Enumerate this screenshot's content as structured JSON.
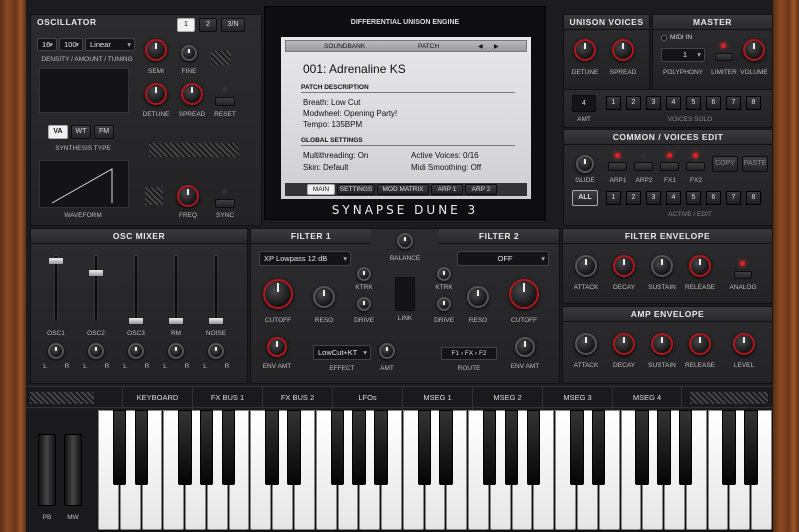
{
  "oscillator": {
    "title": "OSCILLATOR",
    "mode_buttons": [
      "1",
      "2",
      "3/N"
    ],
    "density": "16",
    "amount": "100",
    "tuning": "Linear",
    "density_label": "DENSITY / AMOUNT / TUNING",
    "semi": "SEMI",
    "fine": "FINE",
    "detune": "DETUNE",
    "spread": "SPREAD",
    "reset": "RESET",
    "synth_types": [
      "VA",
      "WT",
      "FM"
    ],
    "synthesis_type_label": "SYNTHESIS TYPE",
    "waveform": "WAVEFORM",
    "freq": "FREQ",
    "sync": "SYNC"
  },
  "engine": {
    "title": "DIFFERENTIAL UNISON ENGINE",
    "nav_soundbank": "SOUNDBANK",
    "nav_patch": "PATCH",
    "nav_prev": "◀",
    "nav_next": "▶",
    "patch_name": "001: Adrenaline KS",
    "patch_desc_title": "PATCH DESCRIPTION",
    "desc_lines": [
      "Breath: Low Cut",
      "Modwheel: Opening Party!",
      "Tempo: 135BPM"
    ],
    "global_title": "GLOBAL SETTINGS",
    "multithreading": "Multithreading: On",
    "active_voices": "Active Voices: 0/16",
    "skin": "Skin: Default",
    "midi_smoothing": "Midi Smoothing: Off",
    "tabs": [
      "MAIN",
      "SETTINGS",
      "MOD MATRIX",
      "ARP 1",
      "ARP 2"
    ],
    "logo": "SYNAPSE DUNE 3"
  },
  "unison": {
    "title": "UNISON VOICES",
    "detune": "DETUNE",
    "spread": "SPREAD",
    "amt_value": "4",
    "amt": "AMT",
    "voices": [
      "1",
      "2",
      "3",
      "4",
      "5",
      "6",
      "7",
      "8"
    ],
    "voices_solo": "VOICES SOLO"
  },
  "master": {
    "title": "MASTER",
    "midi_in": "MIDI IN",
    "polyphony_value": "1",
    "polyphony": "POLYPHONY",
    "limiter": "LIMITER",
    "volume": "VOLUME"
  },
  "common": {
    "title": "COMMON / VOICES EDIT",
    "glide": "GLIDE",
    "arps": [
      "ARP1",
      "ARP2",
      "FX1",
      "FX2"
    ],
    "copy": "COPY",
    "paste": "PASTE",
    "all": "ALL",
    "voices": [
      "1",
      "2",
      "3",
      "4",
      "5",
      "6",
      "7",
      "8"
    ],
    "active_edit": "ACTIVE / EDIT"
  },
  "osc_mixer": {
    "title": "OSC MIXER",
    "channels": [
      "OSC1",
      "OSC2",
      "OSC3",
      "RM",
      "NOISE"
    ],
    "l": "L",
    "r": "R"
  },
  "filters": {
    "filter1": "FILTER 1",
    "filter2": "FILTER 2",
    "filter1_type": "XP Lowpass 12 dB",
    "filter2_type": "OFF",
    "balance": "BALANCE",
    "cutoff": "CUTOFF",
    "reso": "RESO",
    "ktrk": "KTRK",
    "drive": "DRIVE",
    "link": "LINK",
    "env_amt": "ENV AMT",
    "effect_value": "LowCut+KT",
    "effect": "EFFECT",
    "amt": "AMT",
    "route": "ROUTE",
    "route_f1": "F1",
    "route_fx": "FX",
    "route_f2": "F2"
  },
  "filter_env": {
    "title": "FILTER ENVELOPE",
    "attack": "ATTACK",
    "decay": "DECAY",
    "sustain": "SUSTAIN",
    "release": "RELEASE",
    "analog": "ANALOG"
  },
  "amp_env": {
    "title": "AMP ENVELOPE",
    "attack": "ATTACK",
    "decay": "DECAY",
    "sustain": "SUSTAIN",
    "release": "RELEASE",
    "level": "LEVEL"
  },
  "bottom_tabs": [
    "KEYBOARD",
    "FX BUS 1",
    "FX BUS 2",
    "LFOs",
    "MSEG 1",
    "MSEG 2",
    "MSEG 3",
    "MSEG 4"
  ],
  "wheels": {
    "pb": "PB",
    "mw": "MW"
  }
}
